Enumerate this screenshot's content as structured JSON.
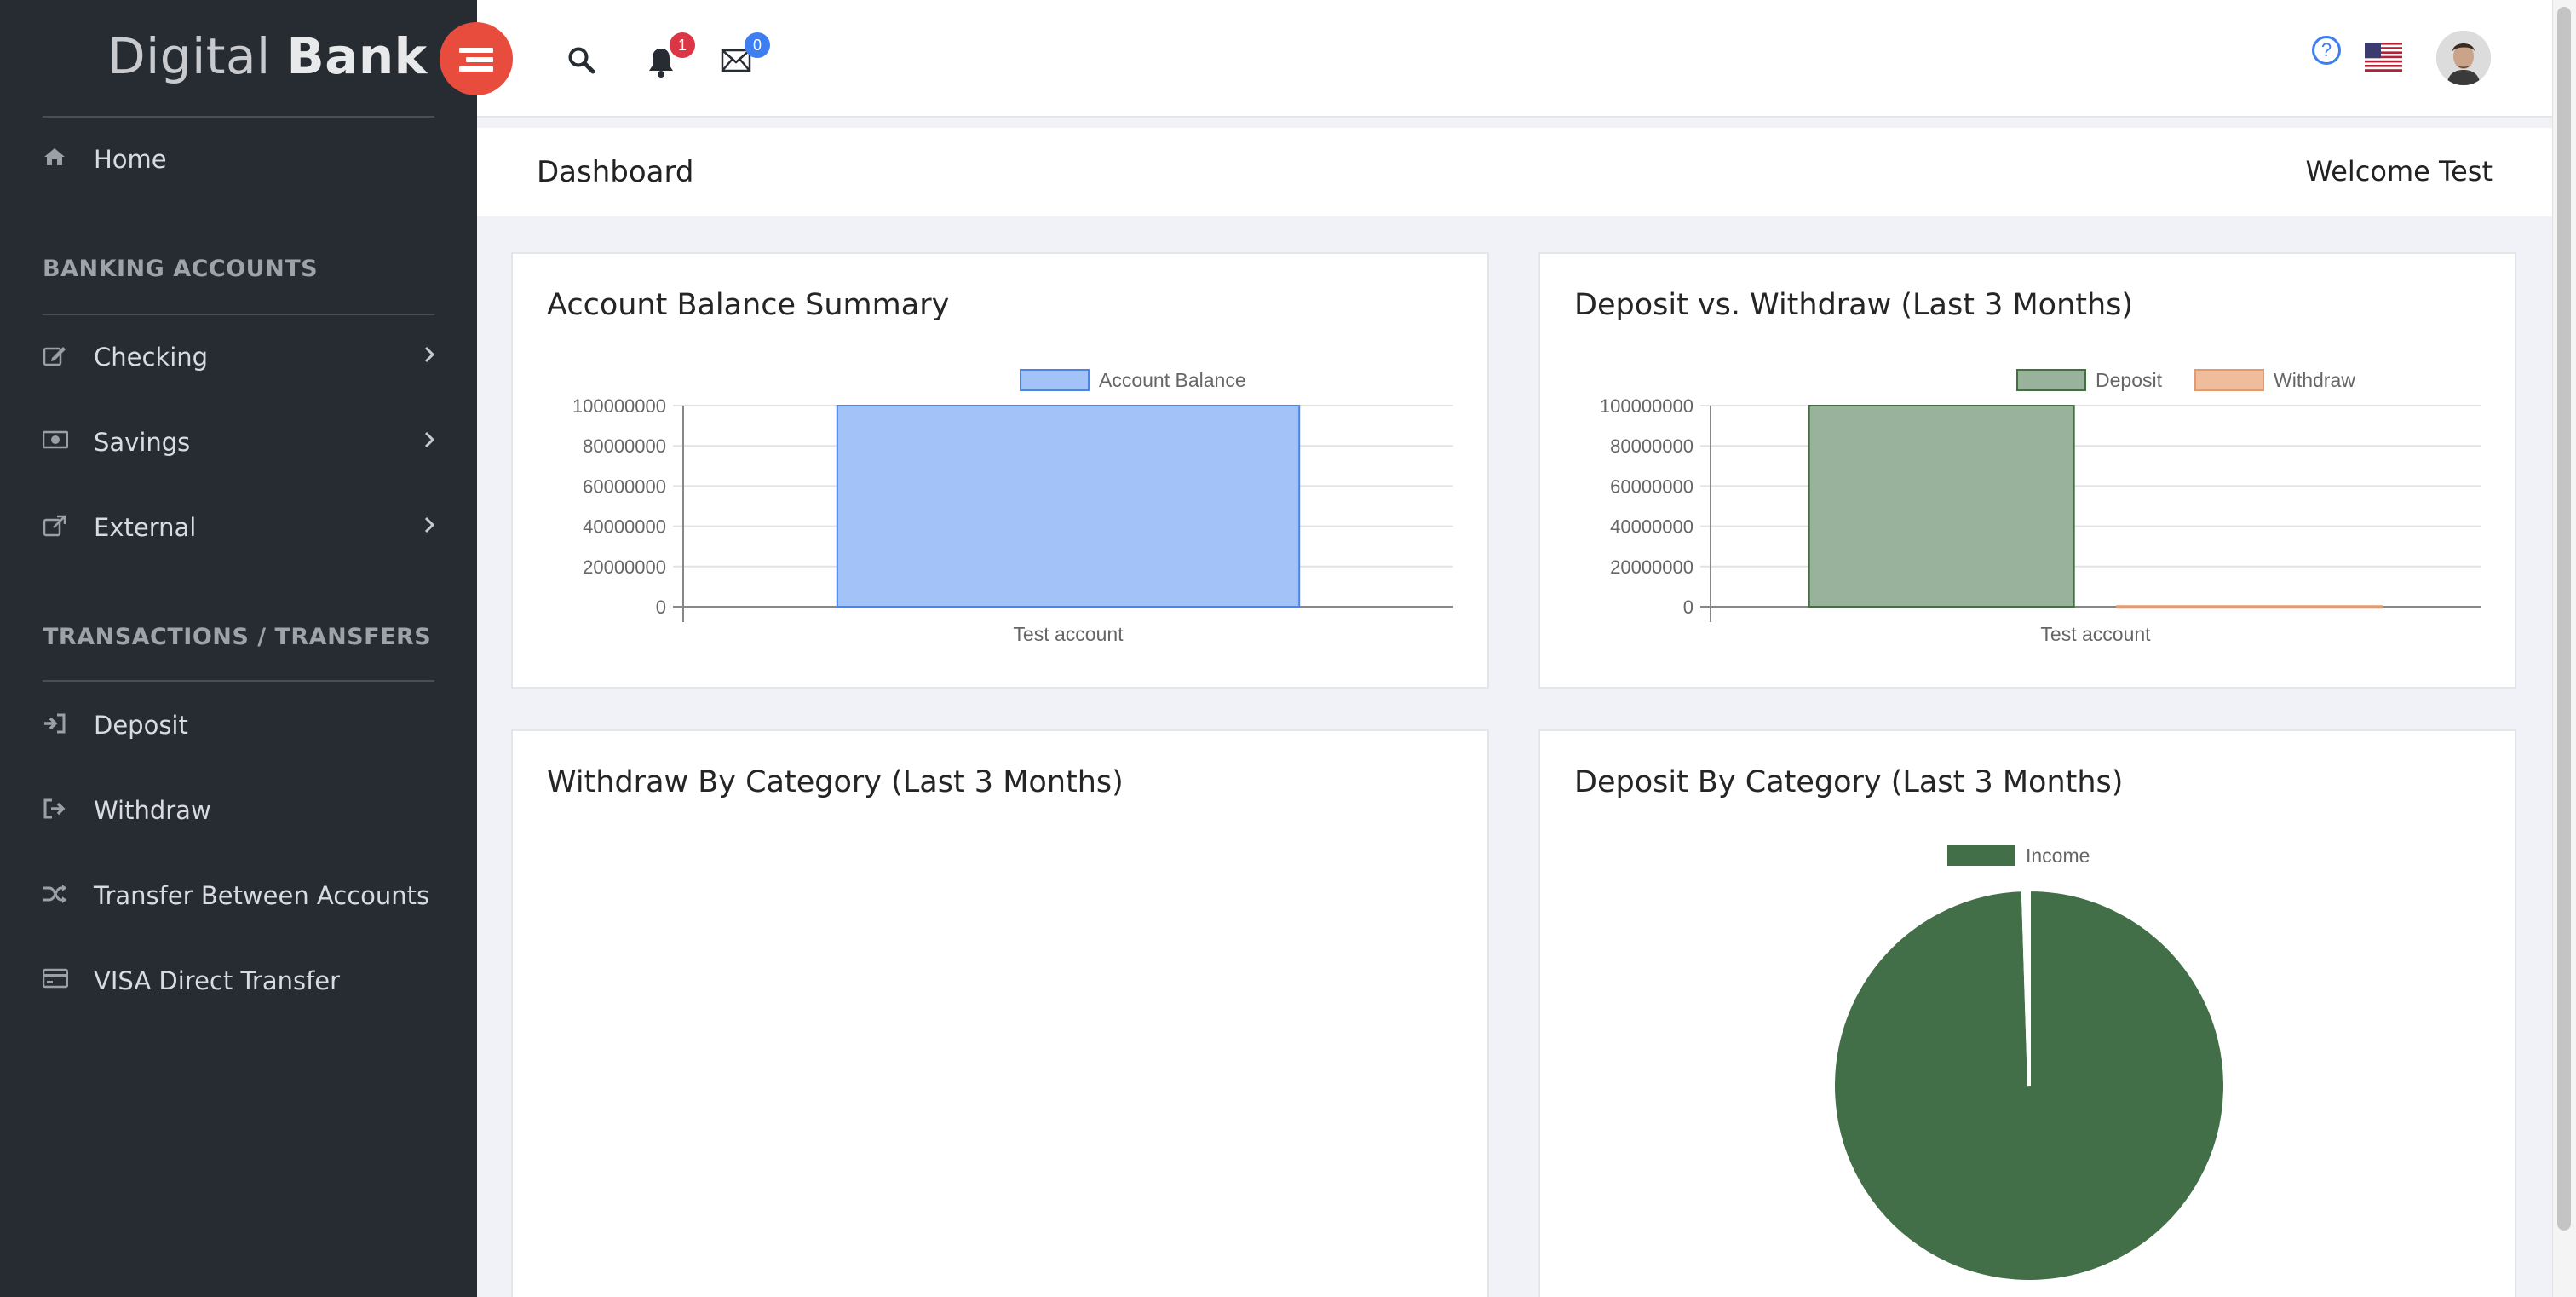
{
  "brand": {
    "light": "Digital",
    "bold": "Bank"
  },
  "sidebar": {
    "home": {
      "label": "Home",
      "icon": "home-icon"
    },
    "sections": [
      {
        "title": "BANKING ACCOUNTS"
      },
      {
        "title": "TRANSACTIONS / TRANSFERS"
      }
    ],
    "items": [
      {
        "label": "Checking",
        "icon": "edit-icon"
      },
      {
        "label": "Savings",
        "icon": "money-icon"
      },
      {
        "label": "External",
        "icon": "external-link-icon"
      },
      {
        "label": "Deposit",
        "icon": "sign-in-icon"
      },
      {
        "label": "Withdraw",
        "icon": "sign-out-icon"
      },
      {
        "label": "Transfer Between Accounts",
        "icon": "shuffle-icon"
      },
      {
        "label": "VISA Direct Transfer",
        "icon": "credit-card-icon"
      }
    ]
  },
  "header": {
    "notifications_count": "1",
    "messages_count": "0",
    "notification_badge_color": "#dc3545",
    "message_badge_color": "#3d7ef0",
    "help_glyph": "?"
  },
  "titlebar": {
    "title": "Dashboard",
    "welcome": "Welcome Test"
  },
  "cards": {
    "balance": {
      "title": "Account Balance Summary"
    },
    "deposit_vs_withdraw": {
      "title": "Deposit vs. Withdraw (Last 3 Months)"
    },
    "withdraw_by_category": {
      "title": "Withdraw By Category (Last 3 Months)"
    },
    "deposit_by_category": {
      "title": "Deposit By Category (Last 3 Months)"
    }
  },
  "chart_data": [
    {
      "type": "bar",
      "categories": [
        "Test account"
      ],
      "series": [
        {
          "name": "Account Balance",
          "values": [
            100000000
          ],
          "color": "#a2c2f8",
          "border": "#4a84e8"
        }
      ],
      "yticks": [
        "100000000",
        "80000000",
        "60000000",
        "40000000",
        "20000000",
        "0"
      ],
      "ylim": [
        0,
        100000000
      ],
      "legend": "top"
    },
    {
      "type": "bar",
      "categories": [
        "Test account"
      ],
      "series": [
        {
          "name": "Deposit",
          "values": [
            100000000
          ],
          "color": "#98b29c",
          "border": "#42703f"
        },
        {
          "name": "Withdraw",
          "values": [
            300000
          ],
          "color": "#efbc9c",
          "border": "#e39a6e"
        }
      ],
      "yticks": [
        "100000000",
        "80000000",
        "60000000",
        "40000000",
        "20000000",
        "0"
      ],
      "ylim": [
        0,
        100000000
      ],
      "legend": "top"
    },
    {
      "type": "pie",
      "series": [
        {
          "name": "Income",
          "value": 99.5,
          "color": "#426f48"
        },
        {
          "name": "",
          "value": 0.5,
          "color": "#ffffff"
        }
      ],
      "legend": "top"
    }
  ]
}
